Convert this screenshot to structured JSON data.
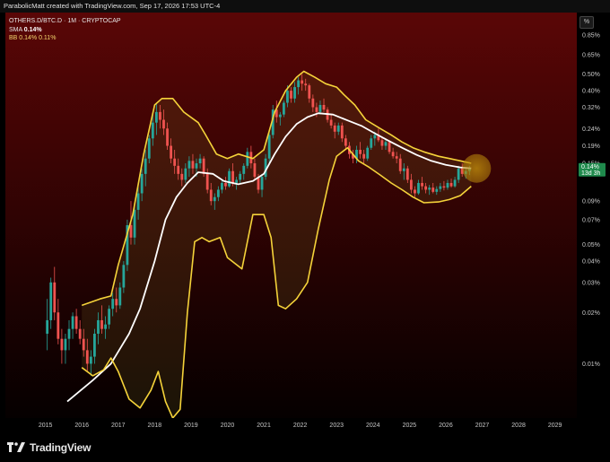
{
  "header": {
    "attribution": "ParabolicMatt created with TradingView.com, Sep 17, 2026 17:53 UTC-4"
  },
  "legend": {
    "symbol": "OTHERS.D/BTC.D · 1M · CRYPTOCAP",
    "sma_name": "SMA",
    "sma_value": "0.14%",
    "bb_name": "BB",
    "bb_values": "0.14%  0.11%"
  },
  "scale_button": "%",
  "price_badge": {
    "value": "0.14%",
    "countdown": "13d 3h"
  },
  "brand": {
    "name": "TradingView"
  },
  "colors": {
    "bg_top": "#5a0606",
    "bg_bottom": "#050000",
    "up": "#26a69a",
    "down": "#ef5350",
    "sma": "#ffffff",
    "bb": "#f5d33a",
    "badge": "#1f8a4c",
    "highlight": "#b8860b"
  },
  "chart_data": {
    "type": "line",
    "y_scale": "log",
    "y_unit": "%",
    "y_ticks": [
      {
        "v": 0.85,
        "label": "0.85%"
      },
      {
        "v": 0.65,
        "label": "0.65%"
      },
      {
        "v": 0.5,
        "label": "0.50%"
      },
      {
        "v": 0.4,
        "label": "0.40%"
      },
      {
        "v": 0.32,
        "label": "0.32%"
      },
      {
        "v": 0.24,
        "label": "0.24%"
      },
      {
        "v": 0.19,
        "label": "0.19%"
      },
      {
        "v": 0.15,
        "label": "0.15%"
      },
      {
        "v": 0.09,
        "label": "0.09%"
      },
      {
        "v": 0.07,
        "label": "0.07%"
      },
      {
        "v": 0.05,
        "label": "0.05%"
      },
      {
        "v": 0.04,
        "label": "0.04%"
      },
      {
        "v": 0.03,
        "label": "0.03%"
      },
      {
        "v": 0.02,
        "label": "0.02%"
      },
      {
        "v": 0.01,
        "label": "0.01%"
      }
    ],
    "x_ticks": [
      "2015",
      "2016",
      "2017",
      "2018",
      "2019",
      "2020",
      "2021",
      "2022",
      "2023",
      "2024",
      "2025",
      "2026",
      "2027",
      "2028",
      "2029"
    ],
    "ylim": [
      0.0048,
      1.15
    ],
    "xlim": [
      2013.9,
      2029.6
    ],
    "series": [
      {
        "type": "line",
        "x": [
          2015.6,
          2016.3,
          2016.8,
          2017.3,
          2017.6,
          2018.0,
          2018.3,
          2018.6,
          2018.9,
          2019.2,
          2019.6,
          2019.9,
          2020.3,
          2020.7,
          2021.0,
          2021.3,
          2021.6,
          2021.9,
          2022.2,
          2022.5,
          2022.9,
          2023.3,
          2023.7,
          2024.0,
          2024.4,
          2024.8,
          2025.2,
          2025.6,
          2026.0,
          2026.4,
          2026.7
        ],
        "y": [
          0.006,
          0.008,
          0.01,
          0.015,
          0.021,
          0.04,
          0.07,
          0.095,
          0.115,
          0.133,
          0.13,
          0.118,
          0.113,
          0.118,
          0.13,
          0.17,
          0.215,
          0.255,
          0.28,
          0.295,
          0.29,
          0.268,
          0.248,
          0.228,
          0.205,
          0.185,
          0.168,
          0.155,
          0.147,
          0.142,
          0.14
        ]
      },
      {
        "type": "line",
        "x": [
          2016.0,
          2016.5,
          2016.8,
          2017.0,
          2017.4,
          2017.7,
          2018.0,
          2018.2,
          2018.5,
          2018.8,
          2019.2,
          2019.4,
          2019.7,
          2020.0,
          2020.3,
          2020.7,
          2021.0,
          2021.3,
          2021.6,
          2021.9,
          2022.1,
          2022.4,
          2022.7,
          2023.0,
          2023.2,
          2023.5,
          2023.8,
          2024.2,
          2024.5,
          2024.8,
          2025.1,
          2025.4,
          2025.8,
          2026.1,
          2026.4,
          2026.7
        ],
        "y": [
          0.022,
          0.024,
          0.025,
          0.038,
          0.075,
          0.17,
          0.33,
          0.36,
          0.36,
          0.3,
          0.26,
          0.22,
          0.17,
          0.16,
          0.17,
          0.16,
          0.18,
          0.3,
          0.4,
          0.48,
          0.52,
          0.48,
          0.44,
          0.42,
          0.38,
          0.33,
          0.27,
          0.24,
          0.22,
          0.2,
          0.185,
          0.175,
          0.165,
          0.16,
          0.155,
          0.15
        ]
      },
      {
        "type": "line",
        "x": [
          2016.0,
          2016.3,
          2016.6,
          2016.8,
          2017.0,
          2017.3,
          2017.6,
          2017.9,
          2018.1,
          2018.3,
          2018.5,
          2018.7,
          2018.9,
          2019.1,
          2019.3,
          2019.5,
          2019.8,
          2020.0,
          2020.4,
          2020.7,
          2021.0,
          2021.2,
          2021.4,
          2021.6,
          2021.9,
          2022.2,
          2022.5,
          2022.8,
          2023.0,
          2023.3,
          2023.6,
          2023.9,
          2024.2,
          2024.5,
          2024.8,
          2025.1,
          2025.4,
          2025.8,
          2026.1,
          2026.4,
          2026.7
        ],
        "y": [
          0.0095,
          0.0085,
          0.0092,
          0.0108,
          0.009,
          0.0062,
          0.0055,
          0.007,
          0.009,
          0.006,
          0.0048,
          0.0054,
          0.02,
          0.052,
          0.055,
          0.052,
          0.055,
          0.042,
          0.036,
          0.075,
          0.075,
          0.055,
          0.022,
          0.021,
          0.024,
          0.03,
          0.062,
          0.12,
          0.165,
          0.185,
          0.155,
          0.142,
          0.128,
          0.115,
          0.105,
          0.095,
          0.088,
          0.089,
          0.092,
          0.097,
          0.11
        ]
      }
    ],
    "candles_note": "monthly candlesticks",
    "candles": [
      [
        2015.05,
        0.015,
        0.024,
        0.012,
        0.018
      ],
      [
        2015.15,
        0.018,
        0.032,
        0.016,
        0.03
      ],
      [
        2015.25,
        0.03,
        0.037,
        0.018,
        0.02
      ],
      [
        2015.35,
        0.02,
        0.024,
        0.013,
        0.014
      ],
      [
        2015.45,
        0.014,
        0.016,
        0.01,
        0.012
      ],
      [
        2015.55,
        0.012,
        0.015,
        0.01,
        0.014
      ],
      [
        2015.65,
        0.014,
        0.018,
        0.012,
        0.016
      ],
      [
        2015.75,
        0.016,
        0.02,
        0.014,
        0.019
      ],
      [
        2015.85,
        0.019,
        0.021,
        0.015,
        0.016
      ],
      [
        2015.95,
        0.016,
        0.018,
        0.013,
        0.014
      ],
      [
        2016.05,
        0.014,
        0.016,
        0.011,
        0.012
      ],
      [
        2016.15,
        0.012,
        0.014,
        0.009,
        0.01
      ],
      [
        2016.25,
        0.01,
        0.012,
        0.0085,
        0.011
      ],
      [
        2016.35,
        0.011,
        0.016,
        0.01,
        0.015
      ],
      [
        2016.45,
        0.015,
        0.02,
        0.013,
        0.018
      ],
      [
        2016.55,
        0.018,
        0.022,
        0.015,
        0.016
      ],
      [
        2016.65,
        0.016,
        0.019,
        0.014,
        0.017
      ],
      [
        2016.75,
        0.017,
        0.022,
        0.016,
        0.021
      ],
      [
        2016.85,
        0.021,
        0.026,
        0.019,
        0.024
      ],
      [
        2016.95,
        0.024,
        0.028,
        0.02,
        0.022
      ],
      [
        2017.05,
        0.022,
        0.03,
        0.021,
        0.028
      ],
      [
        2017.15,
        0.028,
        0.04,
        0.026,
        0.038
      ],
      [
        2017.25,
        0.038,
        0.07,
        0.035,
        0.065
      ],
      [
        2017.35,
        0.065,
        0.09,
        0.05,
        0.055
      ],
      [
        2017.45,
        0.055,
        0.085,
        0.05,
        0.08
      ],
      [
        2017.55,
        0.08,
        0.11,
        0.07,
        0.1
      ],
      [
        2017.65,
        0.1,
        0.14,
        0.09,
        0.13
      ],
      [
        2017.75,
        0.13,
        0.18,
        0.11,
        0.16
      ],
      [
        2017.85,
        0.16,
        0.22,
        0.15,
        0.21
      ],
      [
        2017.95,
        0.21,
        0.29,
        0.19,
        0.26
      ],
      [
        2018.05,
        0.26,
        0.34,
        0.22,
        0.3
      ],
      [
        2018.15,
        0.3,
        0.33,
        0.24,
        0.27
      ],
      [
        2018.25,
        0.27,
        0.31,
        0.22,
        0.24
      ],
      [
        2018.35,
        0.24,
        0.26,
        0.18,
        0.19
      ],
      [
        2018.45,
        0.19,
        0.21,
        0.15,
        0.16
      ],
      [
        2018.55,
        0.16,
        0.18,
        0.13,
        0.145
      ],
      [
        2018.65,
        0.145,
        0.16,
        0.12,
        0.13
      ],
      [
        2018.75,
        0.13,
        0.14,
        0.11,
        0.12
      ],
      [
        2018.85,
        0.12,
        0.15,
        0.115,
        0.14
      ],
      [
        2018.95,
        0.14,
        0.165,
        0.125,
        0.155
      ],
      [
        2019.05,
        0.155,
        0.17,
        0.13,
        0.14
      ],
      [
        2019.15,
        0.14,
        0.16,
        0.125,
        0.15
      ],
      [
        2019.25,
        0.15,
        0.17,
        0.14,
        0.16
      ],
      [
        2019.35,
        0.16,
        0.165,
        0.125,
        0.13
      ],
      [
        2019.45,
        0.13,
        0.14,
        0.1,
        0.105
      ],
      [
        2019.55,
        0.105,
        0.115,
        0.085,
        0.09
      ],
      [
        2019.65,
        0.09,
        0.1,
        0.08,
        0.095
      ],
      [
        2019.75,
        0.095,
        0.11,
        0.09,
        0.105
      ],
      [
        2019.85,
        0.105,
        0.12,
        0.1,
        0.115
      ],
      [
        2019.95,
        0.115,
        0.125,
        0.105,
        0.11
      ],
      [
        2020.05,
        0.11,
        0.14,
        0.108,
        0.135
      ],
      [
        2020.15,
        0.135,
        0.15,
        0.11,
        0.115
      ],
      [
        2020.25,
        0.115,
        0.125,
        0.105,
        0.12
      ],
      [
        2020.35,
        0.12,
        0.135,
        0.115,
        0.13
      ],
      [
        2020.45,
        0.13,
        0.15,
        0.12,
        0.145
      ],
      [
        2020.55,
        0.145,
        0.185,
        0.14,
        0.175
      ],
      [
        2020.65,
        0.175,
        0.19,
        0.14,
        0.15
      ],
      [
        2020.75,
        0.15,
        0.16,
        0.12,
        0.125
      ],
      [
        2020.85,
        0.125,
        0.13,
        0.1,
        0.105
      ],
      [
        2020.95,
        0.105,
        0.13,
        0.095,
        0.125
      ],
      [
        2021.05,
        0.125,
        0.17,
        0.12,
        0.16
      ],
      [
        2021.15,
        0.16,
        0.23,
        0.15,
        0.22
      ],
      [
        2021.25,
        0.22,
        0.33,
        0.21,
        0.31
      ],
      [
        2021.35,
        0.31,
        0.35,
        0.26,
        0.28
      ],
      [
        2021.45,
        0.28,
        0.3,
        0.25,
        0.29
      ],
      [
        2021.55,
        0.29,
        0.35,
        0.28,
        0.34
      ],
      [
        2021.65,
        0.34,
        0.43,
        0.32,
        0.4
      ],
      [
        2021.75,
        0.4,
        0.42,
        0.34,
        0.36
      ],
      [
        2021.85,
        0.36,
        0.45,
        0.34,
        0.42
      ],
      [
        2021.95,
        0.42,
        0.48,
        0.38,
        0.46
      ],
      [
        2022.05,
        0.46,
        0.5,
        0.4,
        0.44
      ],
      [
        2022.15,
        0.44,
        0.47,
        0.4,
        0.43
      ],
      [
        2022.25,
        0.43,
        0.44,
        0.34,
        0.36
      ],
      [
        2022.35,
        0.36,
        0.38,
        0.3,
        0.32
      ],
      [
        2022.45,
        0.32,
        0.34,
        0.28,
        0.3
      ],
      [
        2022.55,
        0.3,
        0.35,
        0.29,
        0.33
      ],
      [
        2022.65,
        0.33,
        0.36,
        0.3,
        0.31
      ],
      [
        2022.75,
        0.31,
        0.32,
        0.26,
        0.27
      ],
      [
        2022.85,
        0.27,
        0.29,
        0.24,
        0.25
      ],
      [
        2022.95,
        0.25,
        0.26,
        0.21,
        0.23
      ],
      [
        2023.05,
        0.23,
        0.26,
        0.22,
        0.25
      ],
      [
        2023.15,
        0.25,
        0.26,
        0.2,
        0.21
      ],
      [
        2023.25,
        0.21,
        0.22,
        0.18,
        0.19
      ],
      [
        2023.35,
        0.19,
        0.2,
        0.16,
        0.17
      ],
      [
        2023.45,
        0.17,
        0.18,
        0.15,
        0.16
      ],
      [
        2023.55,
        0.16,
        0.19,
        0.15,
        0.18
      ],
      [
        2023.65,
        0.18,
        0.2,
        0.16,
        0.17
      ],
      [
        2023.75,
        0.17,
        0.18,
        0.15,
        0.16
      ],
      [
        2023.85,
        0.16,
        0.19,
        0.155,
        0.185
      ],
      [
        2023.95,
        0.185,
        0.22,
        0.18,
        0.21
      ],
      [
        2024.05,
        0.21,
        0.23,
        0.19,
        0.22
      ],
      [
        2024.15,
        0.22,
        0.24,
        0.2,
        0.205
      ],
      [
        2024.25,
        0.205,
        0.215,
        0.18,
        0.19
      ],
      [
        2024.35,
        0.19,
        0.21,
        0.18,
        0.2
      ],
      [
        2024.45,
        0.2,
        0.205,
        0.17,
        0.175
      ],
      [
        2024.55,
        0.175,
        0.185,
        0.16,
        0.165
      ],
      [
        2024.65,
        0.165,
        0.175,
        0.15,
        0.16
      ],
      [
        2024.75,
        0.16,
        0.17,
        0.13,
        0.135
      ],
      [
        2024.85,
        0.135,
        0.15,
        0.12,
        0.14
      ],
      [
        2024.95,
        0.14,
        0.145,
        0.115,
        0.12
      ],
      [
        2025.05,
        0.12,
        0.13,
        0.1,
        0.105
      ],
      [
        2025.15,
        0.105,
        0.11,
        0.095,
        0.1
      ],
      [
        2025.25,
        0.1,
        0.12,
        0.098,
        0.115
      ],
      [
        2025.35,
        0.115,
        0.125,
        0.105,
        0.11
      ],
      [
        2025.45,
        0.11,
        0.115,
        0.1,
        0.105
      ],
      [
        2025.55,
        0.105,
        0.112,
        0.098,
        0.108
      ],
      [
        2025.65,
        0.108,
        0.115,
        0.1,
        0.102
      ],
      [
        2025.75,
        0.102,
        0.11,
        0.098,
        0.106
      ],
      [
        2025.85,
        0.106,
        0.115,
        0.102,
        0.11
      ],
      [
        2025.95,
        0.11,
        0.118,
        0.104,
        0.108
      ],
      [
        2026.05,
        0.108,
        0.12,
        0.105,
        0.115
      ],
      [
        2026.15,
        0.115,
        0.122,
        0.108,
        0.11
      ],
      [
        2026.25,
        0.11,
        0.125,
        0.108,
        0.12
      ],
      [
        2026.35,
        0.12,
        0.145,
        0.115,
        0.14
      ],
      [
        2026.45,
        0.14,
        0.15,
        0.125,
        0.13
      ],
      [
        2026.55,
        0.13,
        0.142,
        0.122,
        0.135
      ],
      [
        2026.65,
        0.135,
        0.145,
        0.128,
        0.14
      ]
    ]
  }
}
